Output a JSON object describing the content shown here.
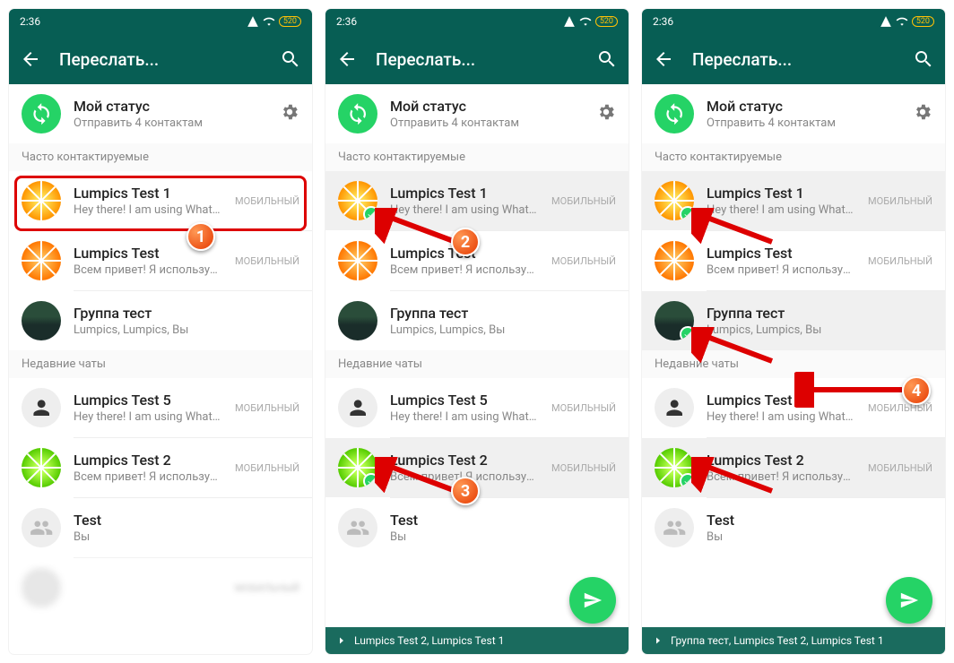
{
  "status": {
    "time": "2:36"
  },
  "header": {
    "title": "Переслать..."
  },
  "my_status": {
    "title": "Мой статус",
    "sub": "Отправить 4 контактам"
  },
  "sections": {
    "frequent": "Часто контактируемые",
    "recent": "Недавние чаты"
  },
  "tags": {
    "mobile": "МОБИЛЬНЫЙ"
  },
  "contacts": {
    "c1": {
      "name": "Lumpics Test 1",
      "sub": "Hey there! I am using WhatsApp."
    },
    "c2": {
      "name": "Lumpics Test",
      "sub": "Всем привет! Я использую WhatsApp."
    },
    "c3": {
      "name": "Группа тест",
      "sub": "Lumpics, Lumpics, Вы"
    },
    "c4": {
      "name": "Lumpics Test 5",
      "sub": "Hey there! I am using WhatsApp."
    },
    "c5": {
      "name": "Lumpics Test 2",
      "sub": "Всем привет! Я использую WhatsApp."
    },
    "c6": {
      "name": "Test",
      "sub": "Вы"
    }
  },
  "selection": {
    "p2": "Lumpics Test 2, Lumpics Test 1",
    "p3": "Группа тест, Lumpics Test 2, Lumpics Test 1"
  },
  "callouts": {
    "n1": "1",
    "n2": "2",
    "n3": "3",
    "n4": "4"
  }
}
